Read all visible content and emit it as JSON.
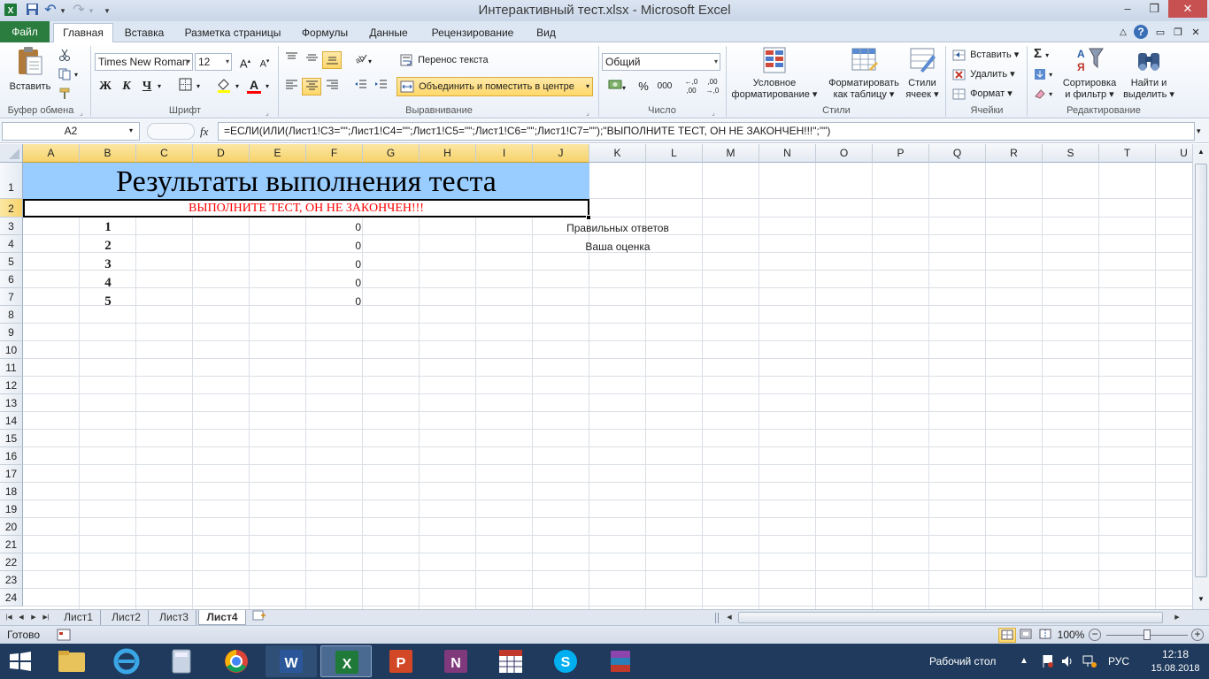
{
  "window": {
    "title": "Интерактивный тест.xlsx  -  Microsoft Excel",
    "minimize": "–",
    "restore": "❐",
    "close": "✕"
  },
  "quick_access": {
    "undo": "↶",
    "redo": "↷",
    "customize": "▾"
  },
  "ribbon_tabs": [
    "Файл",
    "Главная",
    "Вставка",
    "Разметка страницы",
    "Формулы",
    "Данные",
    "Рецензирование",
    "Вид"
  ],
  "ribbon_right": {
    "collapse": "△",
    "help": "?",
    "restore_wb": "▭",
    "restore_win": "❐",
    "close_wb": "✕"
  },
  "clipboard": {
    "paste": "Вставить",
    "group": "Буфер обмена"
  },
  "font": {
    "name": "Times New Roman",
    "size": "12",
    "bold": "Ж",
    "italic": "К",
    "underline": "Ч",
    "group": "Шрифт"
  },
  "alignment": {
    "wrap": "Перенос текста",
    "merge": "Объединить и поместить в центре",
    "group": "Выравнивание"
  },
  "number": {
    "format": "Общий",
    "percent": "%",
    "thousands": "000",
    "group": "Число"
  },
  "styles": {
    "conditional": [
      "Условное",
      "форматирование ▾"
    ],
    "as_table": [
      "Форматировать",
      "как таблицу ▾"
    ],
    "cell_styles": [
      "Стили",
      "ячеек ▾"
    ],
    "group": "Стили"
  },
  "cells": {
    "insert": "Вставить ▾",
    "delete": "Удалить ▾",
    "format": "Формат ▾",
    "group": "Ячейки"
  },
  "editing": {
    "sort": [
      "Сортировка",
      "и фильтр ▾"
    ],
    "find": [
      "Найти и",
      "выделить ▾"
    ],
    "group": "Редактирование"
  },
  "formula_bar": {
    "name_box": "A2",
    "fx": "fx",
    "formula": "=ЕСЛИ(ИЛИ(Лист1!C3=\"\";Лист1!C4=\"\";Лист1!C5=\"\";Лист1!C6=\"\";Лист1!C7=\"\");\"ВЫПОЛНИТЕ ТЕСТ, ОН НЕ ЗАКОНЧЕН!!!\";\"\")"
  },
  "grid": {
    "columns": [
      "A",
      "B",
      "C",
      "D",
      "E",
      "F",
      "G",
      "H",
      "I",
      "J",
      "K",
      "L",
      "M",
      "N",
      "O",
      "P",
      "Q",
      "R",
      "S",
      "T",
      "U"
    ],
    "rows": [
      "1",
      "2",
      "3",
      "4",
      "5",
      "6",
      "7",
      "8",
      "9",
      "10",
      "11",
      "12",
      "13",
      "14",
      "15",
      "16",
      "17",
      "18",
      "19",
      "20",
      "21",
      "22",
      "23",
      "24"
    ],
    "title": "Результаты выполнения теста",
    "warning": "ВЫПОЛНИТЕ ТЕСТ, ОН НЕ ЗАКОНЧЕН!!!",
    "question_numbers": [
      "1",
      "2",
      "3",
      "4",
      "5"
    ],
    "scores": [
      "0",
      "0",
      "0",
      "0",
      "0"
    ],
    "correct_answers_label": "Правильных ответов",
    "grade_label": "Ваша оценка",
    "title_bg": "#99ccff",
    "warning_color": "#ff0000"
  },
  "sheets": [
    "Лист1",
    "Лист2",
    "Лист3",
    "Лист4"
  ],
  "status": {
    "ready": "Готово",
    "zoom": "100%"
  },
  "taskbar": {
    "desktop": "Рабочий стол",
    "lang": "РУС",
    "time": "12:18",
    "date": "15.08.2018"
  }
}
